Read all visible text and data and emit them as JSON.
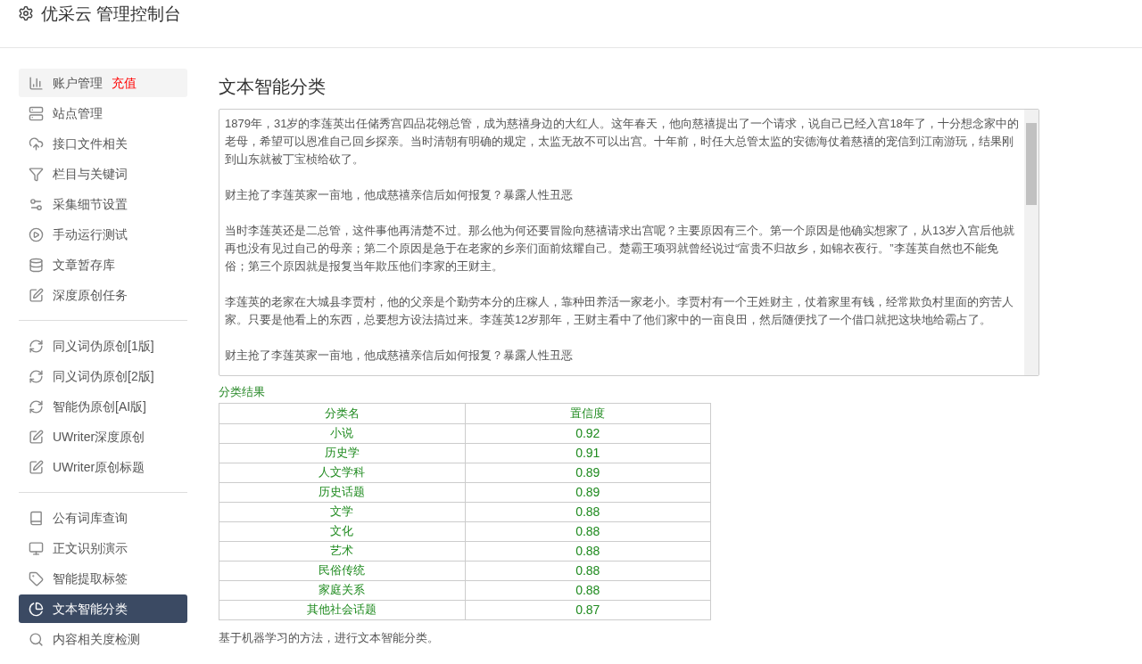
{
  "header": {
    "title": "优采云 管理控制台"
  },
  "sidebar": {
    "groups": [
      {
        "items": [
          {
            "label": "账户管理",
            "badge": "充值",
            "kind": "account",
            "selected": false
          },
          {
            "label": "站点管理",
            "kind": "link",
            "selected": false
          },
          {
            "label": "接口文件相关",
            "kind": "link",
            "selected": false
          },
          {
            "label": "栏目与关键词",
            "kind": "link",
            "selected": false
          },
          {
            "label": "采集细节设置",
            "kind": "link",
            "selected": false
          },
          {
            "label": "手动运行测试",
            "kind": "link",
            "selected": false
          },
          {
            "label": "文章暂存库",
            "kind": "link",
            "selected": false
          },
          {
            "label": "深度原创任务",
            "kind": "link",
            "selected": false
          }
        ]
      },
      {
        "items": [
          {
            "label": "同义词伪原创[1版]",
            "kind": "link",
            "selected": false
          },
          {
            "label": "同义词伪原创[2版]",
            "kind": "link",
            "selected": false
          },
          {
            "label": "智能伪原创[AI版]",
            "kind": "link",
            "selected": false
          },
          {
            "label": "UWriter深度原创",
            "kind": "link",
            "selected": false
          },
          {
            "label": "UWriter原创标题",
            "kind": "link",
            "selected": false
          }
        ]
      },
      {
        "items": [
          {
            "label": "公有词库查询",
            "kind": "link",
            "selected": false
          },
          {
            "label": "正文识别演示",
            "kind": "link",
            "selected": false
          },
          {
            "label": "智能提取标签",
            "kind": "link",
            "selected": false
          },
          {
            "label": "文本智能分类",
            "kind": "link",
            "selected": true
          },
          {
            "label": "内容相关度检测",
            "kind": "link",
            "selected": false
          }
        ]
      }
    ]
  },
  "main": {
    "title": "文本智能分类",
    "text_input": {
      "paragraphs": [
        "1879年，31岁的李莲英出任储秀宫四品花翎总管，成为慈禧身边的大红人。这年春天，他向慈禧提出了一个请求，说自己已经入宫18年了，十分想念家中的老母，希望可以恩准自己回乡探亲。当时清朝有明确的规定，太监无故不可以出宫。十年前，时任大总管太监的安德海仗着慈禧的宠信到江南游玩，结果刚到山东就被丁宝桢给砍了。",
        "财主抢了李莲英家一亩地，他成慈禧亲信后如何报复？暴露人性丑恶",
        "当时李莲英还是二总管，这件事他再清楚不过。那么他为何还要冒险向慈禧请求出宫呢？主要原因有三个。第一个原因是他确实想家了，从13岁入宫后他就再也没有见过自己的母亲；第二个原因是急于在老家的乡亲们面前炫耀自己。楚霸王项羽就曾经说过“富贵不归故乡，如锦衣夜行。”李莲英自然也不能免俗；第三个原因就是报复当年欺压他们李家的王财主。",
        "李莲英的老家在大城县李贾村，他的父亲是个勤劳本分的庄稼人，靠种田养活一家老小。李贾村有一个王姓财主，仗着家里有钱，经常欺负村里面的穷苦人家。只要是他看上的东西，总要想方设法搞过来。李莲英12岁那年，王财主看中了他们家中的一亩良田，然后随便找了一个借口就把这块地给霸占了。",
        "财主抢了李莲英家一亩地，他成慈禧亲信后如何报复？暴露人性丑恶"
      ]
    },
    "result_label": "分类结果",
    "table": {
      "columns": [
        "分类名",
        "置信度"
      ],
      "rows": [
        [
          "小说",
          "0.92"
        ],
        [
          "历史学",
          "0.91"
        ],
        [
          "人文学科",
          "0.89"
        ],
        [
          "历史话题",
          "0.89"
        ],
        [
          "文学",
          "0.88"
        ],
        [
          "文化",
          "0.88"
        ],
        [
          "艺术",
          "0.88"
        ],
        [
          "民俗传统",
          "0.88"
        ],
        [
          "家庭关系",
          "0.88"
        ],
        [
          "其他社会话题",
          "0.87"
        ]
      ]
    },
    "note": "基于机器学习的方法，进行文本智能分类。"
  }
}
